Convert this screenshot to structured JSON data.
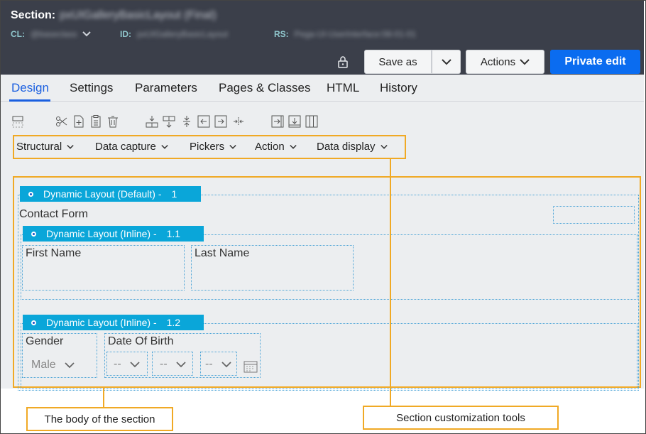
{
  "header": {
    "section_label": "Section:",
    "section_name": "pxUIGalleryBasicLayout (Final)",
    "cl_label": "CL:",
    "cl_value": "@baseclass",
    "id_label": "ID:",
    "id_value": "pxUIGalleryBasicLayout",
    "rs_label": "RS:",
    "rs_value": "Pega-UI-UserInterface:08-01-01",
    "save_as": "Save as",
    "actions": "Actions",
    "private_edit": "Private edit"
  },
  "tabs": [
    "Design",
    "Settings",
    "Parameters",
    "Pages & Classes",
    "HTML",
    "History"
  ],
  "active_tab": "Design",
  "toolbar_icons": [
    "layout-toggle-icon",
    "cut-icon",
    "add-icon",
    "paste-icon",
    "delete-icon",
    "insert-row-icon",
    "insert-row-below-icon",
    "split-icon",
    "move-left-icon",
    "move-right-icon",
    "merge-icon",
    "insert-column-left-icon",
    "insert-column-below-icon",
    "columns-icon"
  ],
  "menus": [
    "Structural",
    "Data capture",
    "Pickers",
    "Action",
    "Data display"
  ],
  "layouts": [
    {
      "title": "Dynamic Layout (Default) -",
      "number": "1"
    },
    {
      "title": "Dynamic Layout (Inline) -",
      "number": "1.1"
    },
    {
      "title": "Dynamic Layout (Inline) -",
      "number": "1.2"
    }
  ],
  "fields": {
    "contact_form": "Contact Form",
    "first_name": "First Name",
    "last_name": "Last Name",
    "gender": "Gender",
    "gender_value": "Male",
    "dob": "Date Of Birth",
    "dob_part": "--"
  },
  "callouts": {
    "body": "The body of the section",
    "tools": "Section customization tools"
  },
  "colors": {
    "header_bg": "#3b3f4a",
    "accent_blue": "#0a6cf0",
    "layout_header": "#0aa6d9",
    "highlight": "#f0a925"
  }
}
